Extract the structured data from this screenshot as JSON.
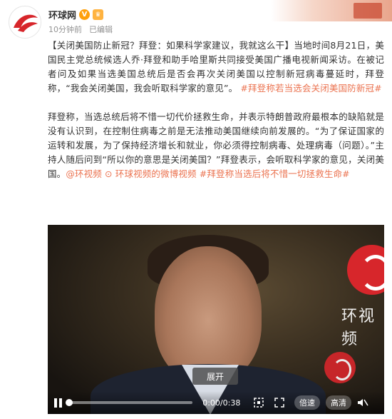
{
  "author": {
    "name": "环球网",
    "verified_mark": "V",
    "member_mark": "♛"
  },
  "meta": {
    "time": "10分钟前",
    "edited": "已编辑"
  },
  "post": {
    "title": "【关闭美国防止新冠？拜登：如果科学家建议，我就这么干】",
    "p1_body": "当地时间8月21日，美国民主党总统候选人乔·拜登和助手哈里斯共同接受美国广播电视新闻采访。在被记者问及如果当选美国总统后是否会再次关闭美国以控制新冠病毒蔓延时，拜登称，“我会关闭美国，我会听取科学家的意见”。",
    "p1_topic": "#拜登称若当选会关闭美国防新冠#",
    "p2_body": "拜登称，当选总统后将不惜一切代价拯救生命，并表示特朗普政府最根本的缺陷就是没有认识到，在控制住病毒之前是无法推动美国继续向前发展的。“为了保证国家的运转和发展，为了保持经济增长和就业，你必须得控制病毒、处理病毒（问题）。”主持人随后问到“所以你的意思是关闭美国？”拜登表示，会听取科学家的意见，关闭美国。",
    "mention": "@环视频",
    "video_link": "环球视频的微博视频",
    "p2_topic": "#拜登称当选后将不惜一切拯救生命#"
  },
  "video": {
    "watermark": "环视频",
    "expand_label": "展开",
    "current_time": "0:00",
    "duration": "0:38",
    "progress": 0.0,
    "speed_label": "倍速",
    "quality_label": "高清"
  },
  "colors": {
    "accent": "#eb7350",
    "brand_red": "#d7262b"
  }
}
